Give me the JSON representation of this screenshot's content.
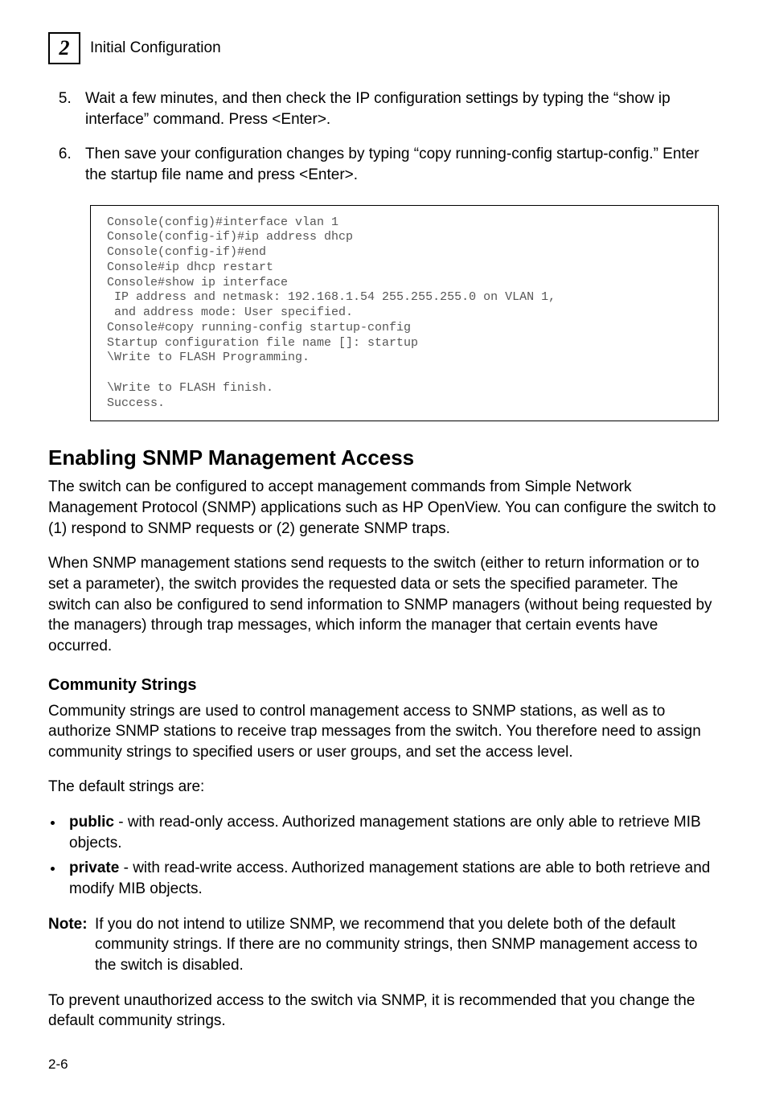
{
  "header": {
    "chapter_number": "2",
    "chapter_title": "Initial Configuration"
  },
  "steps": {
    "start": 5,
    "items": [
      "Wait a few minutes, and then check the IP configuration settings by typing the “show ip interface” command. Press <Enter>.",
      "Then save your configuration changes by typing “copy running-config startup-config.” Enter the startup file name and press <Enter>."
    ]
  },
  "code_block": "Console(config)#interface vlan 1\nConsole(config-if)#ip address dhcp\nConsole(config-if)#end\nConsole#ip dhcp restart\nConsole#show ip interface\n IP address and netmask: 192.168.1.54 255.255.255.0 on VLAN 1,\n and address mode: User specified.\nConsole#copy running-config startup-config\nStartup configuration file name []: startup\n\\Write to FLASH Programming.\n\n\\Write to FLASH finish.\nSuccess.",
  "h2": "Enabling SNMP Management Access",
  "para1": "The switch can be configured to accept management commands from Simple Network Management Protocol (SNMP) applications such as HP OpenView. You can configure the switch to (1) respond to SNMP requests or (2) generate SNMP traps.",
  "para2": "When SNMP management stations send requests to the switch (either to return information or to set a parameter), the switch provides the requested data or sets the specified parameter. The switch can also be configured to send information to SNMP managers (without being requested by the managers) through trap messages, which inform the manager that certain events have occurred.",
  "h3": "Community Strings",
  "para3": "Community strings are used to control management access to SNMP stations, as well as to authorize SNMP stations to receive trap messages from the switch. You therefore need to assign community strings to specified users or user groups, and set the access level.",
  "para4": "The default strings are:",
  "bullets": [
    {
      "term": "public",
      "rest": " - with read-only access. Authorized management stations are only able to retrieve MIB objects."
    },
    {
      "term": "private",
      "rest": " - with read-write access. Authorized management stations are able to both retrieve and modify MIB objects."
    }
  ],
  "note": {
    "label": "Note:",
    "body": "If you do not intend to utilize SNMP, we recommend that you delete both of the default community strings. If there are no community strings, then SNMP management access to the switch is disabled."
  },
  "para5": "To prevent unauthorized access to the switch via SNMP, it is recommended that you change the default community strings.",
  "page_number": "2-6"
}
